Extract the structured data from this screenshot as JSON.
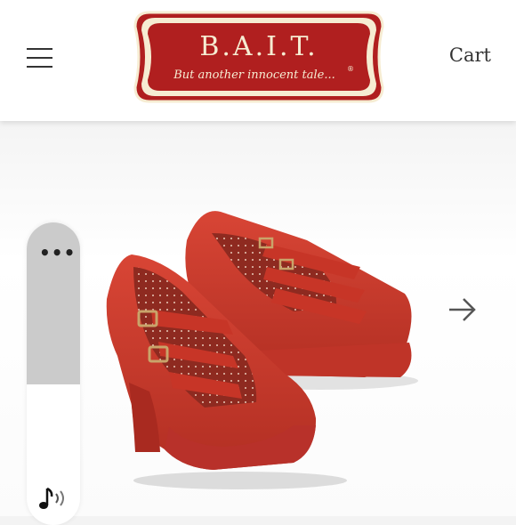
{
  "header": {
    "menu_icon": "hamburger-menu-icon",
    "logo": {
      "title": "B.A.I.T.",
      "tagline": "But another innocent tale...",
      "mark": "®",
      "colors": {
        "primary": "#b01f1f",
        "cream": "#f6ecd2"
      }
    },
    "cart_label": "Cart"
  },
  "product_image": {
    "description_icon": "red-platform-heels-image",
    "colors": {
      "shoe": "#cc3a2d",
      "lining": "#8e2a20"
    }
  },
  "carousel": {
    "next_icon": "arrow-right-icon"
  },
  "side_widget": {
    "more_icon": "more-dots-icon",
    "more_label": "•••",
    "audio_icon": "music-note-sound-icon"
  }
}
